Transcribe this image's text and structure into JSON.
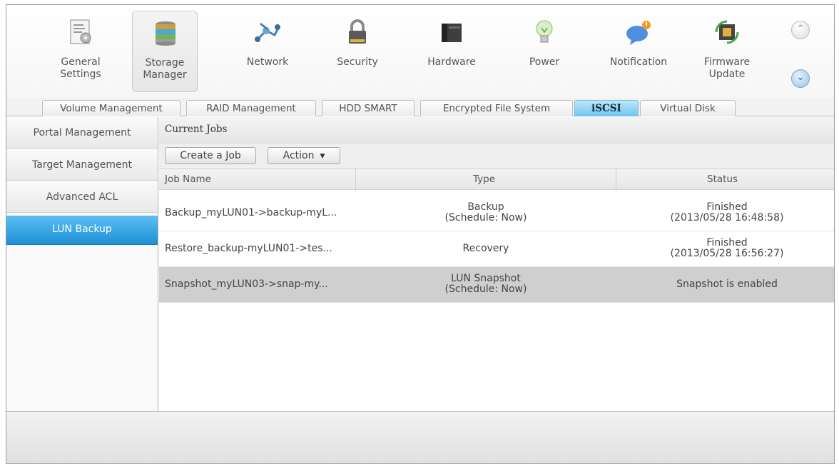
{
  "toolbar": {
    "items": [
      {
        "icon": "general-settings-icon",
        "line1": "General",
        "line2": "Settings"
      },
      {
        "icon": "storage-manager-icon",
        "line1": "Storage",
        "line2": "Manager"
      },
      {
        "icon": "network-icon",
        "line1": "Network",
        "line2": ""
      },
      {
        "icon": "security-lock-icon",
        "line1": "Security",
        "line2": ""
      },
      {
        "icon": "hardware-icon",
        "line1": "Hardware",
        "line2": ""
      },
      {
        "icon": "power-bulb-icon",
        "line1": "Power",
        "line2": ""
      },
      {
        "icon": "notification-icon",
        "line1": "Notification",
        "line2": ""
      },
      {
        "icon": "firmware-chip-icon",
        "line1": "Firmware",
        "line2": "Update"
      }
    ],
    "active_index": 1
  },
  "tabs": {
    "items": [
      "Volume Management",
      "RAID Management",
      "HDD SMART",
      "Encrypted File System",
      "iSCSI",
      "Virtual Disk"
    ],
    "active": "iSCSI"
  },
  "sidebar": {
    "items": [
      "Portal Management",
      "Target Management",
      "Advanced ACL",
      "LUN Backup"
    ],
    "active": "LUN Backup"
  },
  "panel": {
    "title": "Current Jobs",
    "create_button": "Create a Job",
    "action_button": "Action"
  },
  "table": {
    "columns": [
      "Job Name",
      "Type",
      "Status"
    ],
    "rows": [
      {
        "name": "Backup_myLUN01->backup-myL...",
        "type1": "Backup",
        "type2": "(Schedule: Now)",
        "status1": "Finished",
        "status2": "(2013/05/28 16:48:58)"
      },
      {
        "name": "Restore_backup-myLUN01->tes...",
        "type1": "Recovery",
        "type2": "",
        "status1": "Finished",
        "status2": "(2013/05/28 16:56:27)"
      },
      {
        "name": "Snapshot_myLUN03->snap-my...",
        "type1": "LUN Snapshot",
        "type2": "(Schedule: Now)",
        "status1": "Snapshot is enabled",
        "status2": ""
      }
    ],
    "selected_row": 2
  },
  "colors": {
    "accent_blue": "#1e8fd6",
    "selected_row": "#cfcfcf"
  }
}
